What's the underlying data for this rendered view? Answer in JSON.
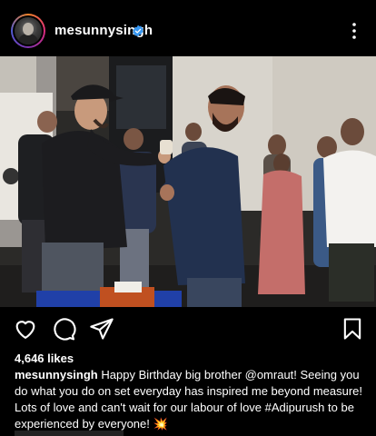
{
  "post": {
    "username": "mesunnysingh",
    "verified": true,
    "likes": "4,646 likes",
    "caption_user": "mesunnysingh",
    "caption_text": "Happy Birthday big brother @omraut! Seeing you do what you do on set everyday has inspired me beyond measure! Lots of love and can't wait for our labour of love #Adipurush to be experienced by everyone!",
    "caption_emoji": "💥"
  },
  "icons": {
    "verified": "verified-badge-icon",
    "more": "more-options-icon",
    "like": "heart-icon",
    "comment": "comment-bubble-icon",
    "share": "paper-plane-icon",
    "save": "bookmark-icon"
  },
  "colors": {
    "background": "#000000",
    "text": "#ffffff",
    "verified": "#3897f0"
  }
}
